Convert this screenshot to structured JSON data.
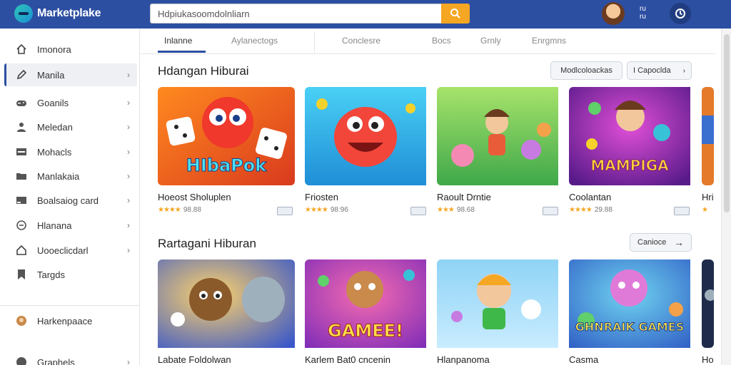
{
  "app": {
    "name": "Marketplake"
  },
  "search": {
    "value": "Hdpiukasoomdolnliarn"
  },
  "user": {
    "line1": "ru",
    "line2": "ru"
  },
  "sidebar": {
    "items": [
      {
        "label": "Imonora",
        "icon": "home-icon"
      },
      {
        "label": "Manila",
        "icon": "pencil-icon"
      },
      {
        "label": "Goanils",
        "icon": "gamepad-icon"
      },
      {
        "label": "Meledan",
        "icon": "person-icon"
      },
      {
        "label": "Mohacls",
        "icon": "window-icon"
      },
      {
        "label": "Manlakaia",
        "icon": "folder-icon"
      },
      {
        "label": "Boalsaiog card",
        "icon": "card-icon"
      },
      {
        "label": "Hlanana",
        "icon": "gear-icon"
      },
      {
        "label": "Uooeclicdarl",
        "icon": "house-icon"
      },
      {
        "label": "Targds",
        "icon": "bookmark-icon"
      },
      {
        "label": "Harkenpaace",
        "icon": "store-icon"
      },
      {
        "label": "Graphels",
        "icon": "circle-icon"
      }
    ]
  },
  "tabs": [
    {
      "label": "Inlanne"
    },
    {
      "label": "Aylanectogs"
    },
    {
      "label": "Conclesre"
    },
    {
      "label": "Bocs"
    },
    {
      "label": "Grnly"
    },
    {
      "label": "Enrgmns"
    }
  ],
  "section1": {
    "title": "Hdangan Hiburai",
    "pill_a": "Modlcoloackas",
    "pill_b": "I Capoclda",
    "cards": [
      {
        "title": "Hoeost Sholuplen",
        "rating": "98.88",
        "stars": "★★★★",
        "art": "HIbaPok",
        "tag": ""
      },
      {
        "title": "Friosten",
        "rating": "98:96",
        "stars": "★★★★",
        "art": "",
        "tag": ""
      },
      {
        "title": "Raoult Drntie",
        "rating": "98.68",
        "stars": "★★★",
        "art": "",
        "tag": ""
      },
      {
        "title": "Coolantan",
        "rating": "29.88",
        "stars": "★★★★",
        "art": "MAMPIGA",
        "tag": ""
      },
      {
        "title": "Hri",
        "rating": "",
        "stars": "★",
        "art": "",
        "tag": ""
      }
    ]
  },
  "section2": {
    "title": "Rartagani Hiburan",
    "pill": "Canioce",
    "cards": [
      {
        "title": "Labate Foldolwan",
        "art": ""
      },
      {
        "title": "Karlem Bat0 cncenin",
        "art": "GAMEE!"
      },
      {
        "title": "Hlanpanoma",
        "art": ""
      },
      {
        "title": "Casma",
        "art": "GHNRAIK GAMES"
      },
      {
        "title": "Ho",
        "art": ""
      }
    ]
  },
  "colors": {
    "brand": "#2d4fa2",
    "accent": "#f5a623"
  }
}
